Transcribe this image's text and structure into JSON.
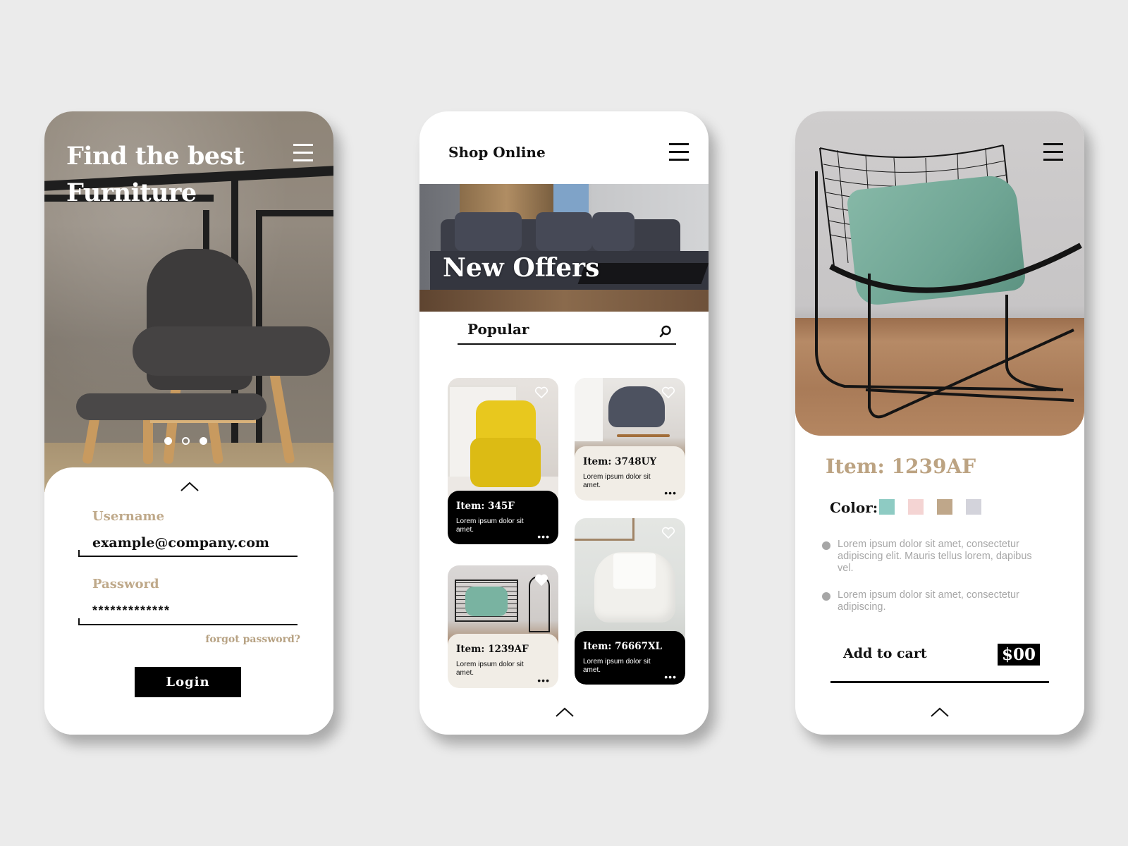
{
  "background_color": "#ebebeb",
  "colors": {
    "accent_tan": "#bca382",
    "text_dark": "#111111",
    "card_light": "#f1ede6",
    "card_dark": "#000000",
    "muted_text": "#a7a7a7"
  },
  "login_screen": {
    "title_line1": "Find the best",
    "title_line2": "Furniture",
    "menu_icon": "hamburger-icon",
    "carousel": {
      "count": 3,
      "active_index": 1
    },
    "collapse_icon": "chevron-up-icon",
    "username_label": "Username",
    "username_value": "example@company.com",
    "password_label": "Password",
    "password_value": "*************",
    "forgot_password": "forgot password?",
    "login_button": "Login"
  },
  "shop_screen": {
    "title": "Shop Online",
    "menu_icon": "hamburger-icon",
    "banner_title": "New Offers",
    "search": {
      "value": "Popular",
      "icon": "search-icon"
    },
    "products": [
      {
        "name": "Item: 345F",
        "description": "Lorem ipsum dolor sit amet.",
        "more": "•••",
        "style": "dark",
        "favorite_icon": "heart-icon"
      },
      {
        "name": "Item: 3748UY",
        "description": "Lorem ipsum dolor sit amet.",
        "more": "•••",
        "style": "light",
        "favorite_icon": "heart-icon"
      },
      {
        "name": "Item: 1239AF",
        "description": "Lorem ipsum dolor sit amet.",
        "more": "•••",
        "style": "light",
        "favorite_icon": "heart-icon"
      },
      {
        "name": "Item: 76667XL",
        "description": "Lorem ipsum dolor sit amet.",
        "more": "•••",
        "style": "dark",
        "favorite_icon": "heart-icon"
      }
    ],
    "collapse_icon": "chevron-up-icon"
  },
  "detail_screen": {
    "menu_icon": "hamburger-icon",
    "item_title": "Item: 1239AF",
    "color_label": "Color:",
    "swatches": [
      "#8ecbc3",
      "#f4d4d3",
      "#bfa78a",
      "#d3d3db"
    ],
    "bullets": [
      "Lorem ipsum dolor sit amet, consectetur adipiscing elit. Mauris tellus lorem, dapibus vel.",
      "Lorem ipsum dolor sit amet, consectetur adipiscing."
    ],
    "add_to_cart": "Add to cart",
    "price": "$00",
    "collapse_icon": "chevron-up-icon"
  }
}
